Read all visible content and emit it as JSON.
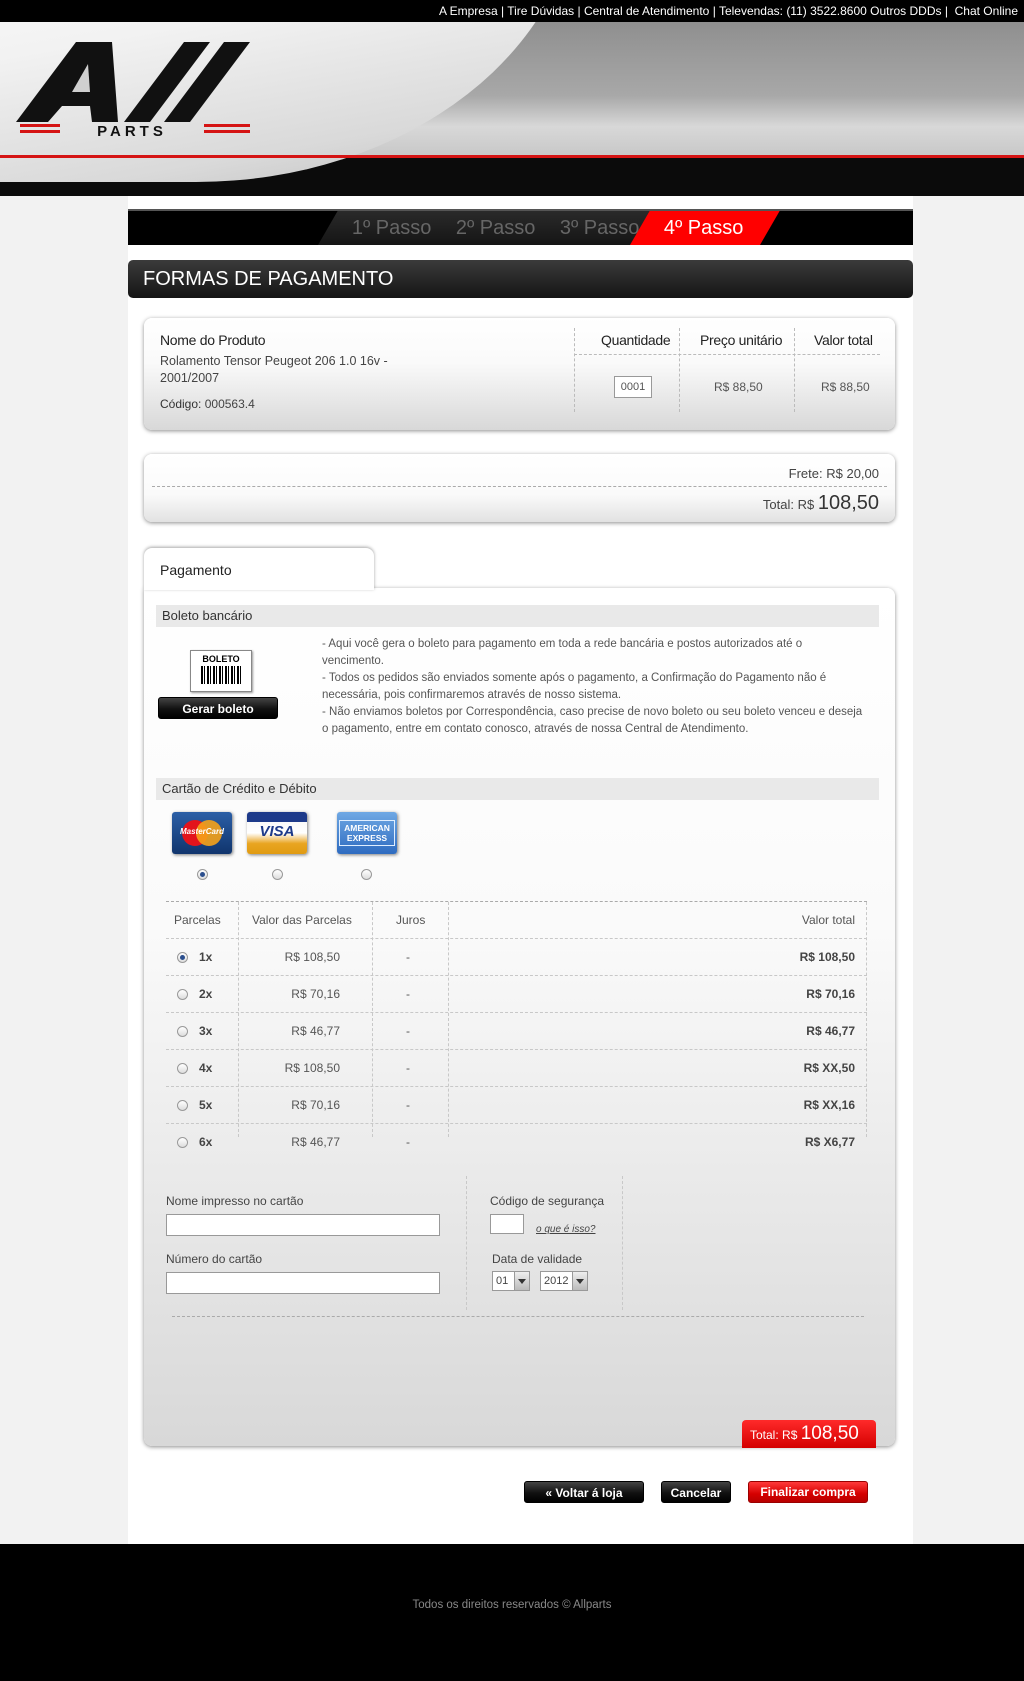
{
  "topbar": {
    "links": [
      "A Empresa",
      "Tire Dúvidas",
      "Central de Atendimento"
    ],
    "televendas": "Televendas: (11) 3522.8600 Outros DDDs",
    "chat": "Chat Online"
  },
  "logo": {
    "big": "All",
    "sub": "PARTS"
  },
  "steps": [
    "1º Passo",
    "2º Passo",
    "3º Passo",
    "4º Passo"
  ],
  "page_title": "FORMAS DE PAGAMENTO",
  "product_table": {
    "headers": {
      "name": "Nome do Produto",
      "qty": "Quantidade",
      "unit": "Preço unitário",
      "total": "Valor total"
    },
    "item": {
      "name": "Rolamento Tensor Peugeot  206  1.0 16v  - 2001/2007",
      "code_label": "Código:",
      "code": "000563.4",
      "qty": "0001",
      "unit_price": "R$ 88,50",
      "total": "R$ 88,50"
    }
  },
  "summary": {
    "frete_label": "Frete:",
    "frete_value": "R$ 20,00",
    "total_label": "Total:",
    "currency": "R$",
    "total_value": "108,50"
  },
  "payment": {
    "tab": "Pagamento",
    "boleto": {
      "heading": "Boleto bancário",
      "icon_label": "BOLETO",
      "button": "Gerar boleto",
      "text": [
        "- Aqui você gera o boleto para pagamento em toda a rede bancária e postos autorizados até o vencimento.",
        "- Todos os pedidos são enviados somente após o pagamento, a Confirmação do Pagamento não é necessária, pois confirmaremos através de nosso sistema.",
        "- Não enviamos boletos por Correspondência, caso precise de novo boleto ou seu boleto venceu e deseja o pagamento, entre em contato conosco, através de nossa Central de Atendimento."
      ]
    },
    "cards": {
      "heading": "Cartão de Crédito e Débito",
      "brands": [
        "MasterCard",
        "VISA",
        "AMERICAN EXPRESS"
      ],
      "selected_index": 0
    },
    "installments": {
      "headers": [
        "Parcelas",
        "Valor das Parcelas",
        "Juros",
        "Valor total"
      ],
      "rows": [
        {
          "n": "1x",
          "value": "R$ 108,50",
          "juros": "-",
          "total": "R$ 108,50"
        },
        {
          "n": "2x",
          "value": "R$ 70,16",
          "juros": "-",
          "total": "R$ 70,16"
        },
        {
          "n": "3x",
          "value": "R$ 46,77",
          "juros": "-",
          "total": "R$ 46,77"
        },
        {
          "n": "4x",
          "value": "R$ 108,50",
          "juros": "-",
          "total": "R$ XX,50"
        },
        {
          "n": "5x",
          "value": "R$ 70,16",
          "juros": "-",
          "total": "R$ XX,16"
        },
        {
          "n": "6x",
          "value": "R$ 46,77",
          "juros": "-",
          "total": "R$ X6,77"
        }
      ],
      "selected_index": 0
    },
    "form": {
      "name_label": "Nome impresso no cartão",
      "number_label": "Número do cartão",
      "cvv_label": "Código de segurança",
      "cvv_help": "o que é isso?",
      "expiry_label": "Data de validade",
      "month": "01",
      "year": "2012"
    },
    "total_box": {
      "label": "Total:",
      "currency": "R$",
      "value": "108,50"
    }
  },
  "buttons": {
    "back": "« Voltar á loja",
    "cancel": "Cancelar",
    "finish": "Finalizar compra"
  },
  "footer": "Todos os direitos reservados © Allparts"
}
